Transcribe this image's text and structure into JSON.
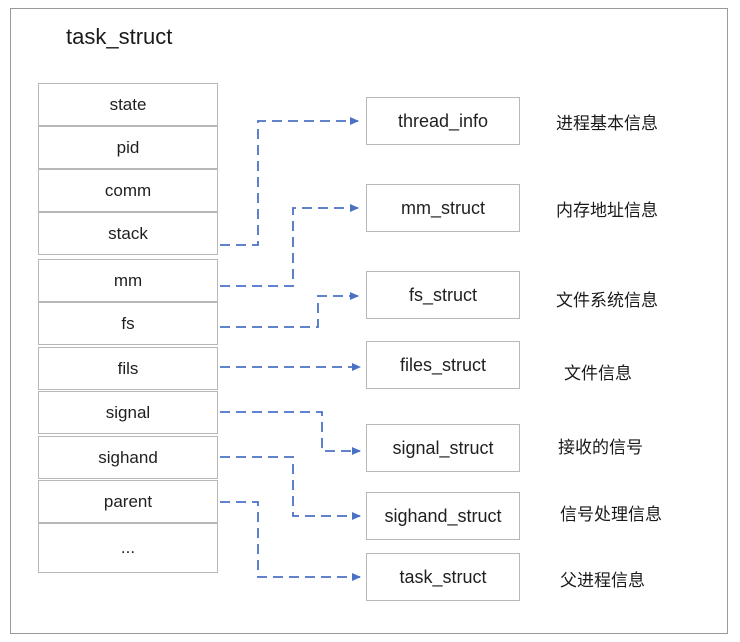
{
  "title": "task_struct",
  "fields": [
    "state",
    "pid",
    "comm",
    "stack",
    "mm",
    "fs",
    "fils",
    "signal",
    "sighand",
    "parent",
    "..."
  ],
  "targets": [
    {
      "label": "thread_info",
      "desc": "进程基本信息",
      "from": "stack"
    },
    {
      "label": "mm_struct",
      "desc": "内存地址信息",
      "from": "mm"
    },
    {
      "label": "fs_struct",
      "desc": "文件系统信息",
      "from": "fs"
    },
    {
      "label": "files_struct",
      "desc": "文件信息",
      "from": "fils"
    },
    {
      "label": "signal_struct",
      "desc": "接收的信号",
      "from": "signal"
    },
    {
      "label": "sighand_struct",
      "desc": "信号处理信息",
      "from": "sighand"
    },
    {
      "label": "task_struct",
      "desc": "父进程信息",
      "from": "parent"
    }
  ],
  "colors": {
    "arrow": "#4a72c4",
    "border": "#b8b8b8"
  }
}
